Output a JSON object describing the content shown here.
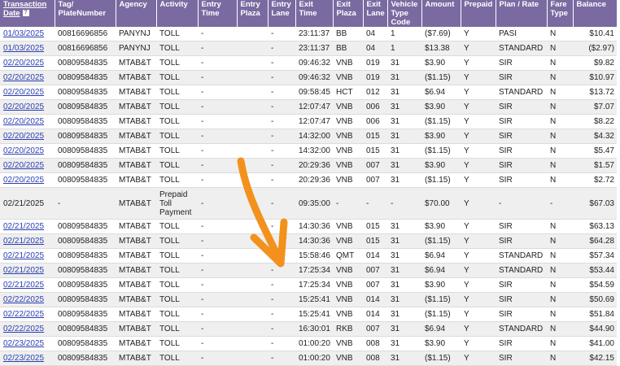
{
  "headers": [
    {
      "lines": [
        "Transaction",
        "Date"
      ],
      "underline": true,
      "help": "?"
    },
    {
      "lines": [
        "Tag/",
        "PlateNumber"
      ]
    },
    {
      "lines": [
        "Agency"
      ]
    },
    {
      "lines": [
        "Activity"
      ]
    },
    {
      "lines": [
        "Entry",
        "Time"
      ]
    },
    {
      "lines": [
        "Entry",
        "Plaza"
      ]
    },
    {
      "lines": [
        "Entry",
        "Lane"
      ]
    },
    {
      "lines": [
        "Exit",
        "Time"
      ]
    },
    {
      "lines": [
        "Exit",
        "Plaza"
      ]
    },
    {
      "lines": [
        "Exit",
        "Lane"
      ]
    },
    {
      "lines": [
        "Vehicle",
        "Type",
        "Code"
      ]
    },
    {
      "lines": [
        "Amount"
      ]
    },
    {
      "lines": [
        "Prepaid"
      ]
    },
    {
      "lines": [
        "Plan / Rate"
      ]
    },
    {
      "lines": [
        "Fare",
        "Type"
      ]
    },
    {
      "lines": [
        "Balance"
      ]
    }
  ],
  "rows": [
    {
      "date": "01/03/2025",
      "link": true,
      "tag": "00816696856",
      "agency": "PANYNJ",
      "activity": "TOLL",
      "entry_time": "-",
      "entry_plaza": "",
      "entry_lane": "-",
      "exit_time": "23:11:37",
      "exit_plaza": "BB",
      "exit_lane": "04",
      "vtc": "1",
      "amount": "($7.69)",
      "prepaid": "Y",
      "plan": "PASI",
      "fare": "N",
      "balance": "$10.41"
    },
    {
      "date": "01/03/2025",
      "link": true,
      "tag": "00816696856",
      "agency": "PANYNJ",
      "activity": "TOLL",
      "entry_time": "-",
      "entry_plaza": "",
      "entry_lane": "-",
      "exit_time": "23:11:37",
      "exit_plaza": "BB",
      "exit_lane": "04",
      "vtc": "1",
      "amount": "$13.38",
      "prepaid": "Y",
      "plan": "STANDARD",
      "fare": "N",
      "balance": "($2.97)"
    },
    {
      "date": "02/20/2025",
      "link": true,
      "tag": "00809584835",
      "agency": "MTAB&T",
      "activity": "TOLL",
      "entry_time": "-",
      "entry_plaza": "",
      "entry_lane": "-",
      "exit_time": "09:46:32",
      "exit_plaza": "VNB",
      "exit_lane": "019",
      "vtc": "31",
      "amount": "$3.90",
      "prepaid": "Y",
      "plan": "SIR",
      "fare": "N",
      "balance": "$9.82"
    },
    {
      "date": "02/20/2025",
      "link": true,
      "tag": "00809584835",
      "agency": "MTAB&T",
      "activity": "TOLL",
      "entry_time": "-",
      "entry_plaza": "",
      "entry_lane": "-",
      "exit_time": "09:46:32",
      "exit_plaza": "VNB",
      "exit_lane": "019",
      "vtc": "31",
      "amount": "($1.15)",
      "prepaid": "Y",
      "plan": "SIR",
      "fare": "N",
      "balance": "$10.97"
    },
    {
      "date": "02/20/2025",
      "link": true,
      "tag": "00809584835",
      "agency": "MTAB&T",
      "activity": "TOLL",
      "entry_time": "-",
      "entry_plaza": "",
      "entry_lane": "-",
      "exit_time": "09:58:45",
      "exit_plaza": "HCT",
      "exit_lane": "012",
      "vtc": "31",
      "amount": "$6.94",
      "prepaid": "Y",
      "plan": "STANDARD",
      "fare": "N",
      "balance": "$13.72"
    },
    {
      "date": "02/20/2025",
      "link": true,
      "tag": "00809584835",
      "agency": "MTAB&T",
      "activity": "TOLL",
      "entry_time": "-",
      "entry_plaza": "",
      "entry_lane": "-",
      "exit_time": "12:07:47",
      "exit_plaza": "VNB",
      "exit_lane": "006",
      "vtc": "31",
      "amount": "$3.90",
      "prepaid": "Y",
      "plan": "SIR",
      "fare": "N",
      "balance": "$7.07"
    },
    {
      "date": "02/20/2025",
      "link": true,
      "tag": "00809584835",
      "agency": "MTAB&T",
      "activity": "TOLL",
      "entry_time": "-",
      "entry_plaza": "",
      "entry_lane": "-",
      "exit_time": "12:07:47",
      "exit_plaza": "VNB",
      "exit_lane": "006",
      "vtc": "31",
      "amount": "($1.15)",
      "prepaid": "Y",
      "plan": "SIR",
      "fare": "N",
      "balance": "$8.22"
    },
    {
      "date": "02/20/2025",
      "link": true,
      "tag": "00809584835",
      "agency": "MTAB&T",
      "activity": "TOLL",
      "entry_time": "-",
      "entry_plaza": "",
      "entry_lane": "-",
      "exit_time": "14:32:00",
      "exit_plaza": "VNB",
      "exit_lane": "015",
      "vtc": "31",
      "amount": "$3.90",
      "prepaid": "Y",
      "plan": "SIR",
      "fare": "N",
      "balance": "$4.32"
    },
    {
      "date": "02/20/2025",
      "link": true,
      "tag": "00809584835",
      "agency": "MTAB&T",
      "activity": "TOLL",
      "entry_time": "-",
      "entry_plaza": "",
      "entry_lane": "-",
      "exit_time": "14:32:00",
      "exit_plaza": "VNB",
      "exit_lane": "015",
      "vtc": "31",
      "amount": "($1.15)",
      "prepaid": "Y",
      "plan": "SIR",
      "fare": "N",
      "balance": "$5.47"
    },
    {
      "date": "02/20/2025",
      "link": true,
      "tag": "00809584835",
      "agency": "MTAB&T",
      "activity": "TOLL",
      "entry_time": "-",
      "entry_plaza": "",
      "entry_lane": "-",
      "exit_time": "20:29:36",
      "exit_plaza": "VNB",
      "exit_lane": "007",
      "vtc": "31",
      "amount": "$3.90",
      "prepaid": "Y",
      "plan": "SIR",
      "fare": "N",
      "balance": "$1.57"
    },
    {
      "date": "02/20/2025",
      "link": true,
      "tag": "00809584835",
      "agency": "MTAB&T",
      "activity": "TOLL",
      "entry_time": "-",
      "entry_plaza": "",
      "entry_lane": "-",
      "exit_time": "20:29:36",
      "exit_plaza": "VNB",
      "exit_lane": "007",
      "vtc": "31",
      "amount": "($1.15)",
      "prepaid": "Y",
      "plan": "SIR",
      "fare": "N",
      "balance": "$2.72"
    },
    {
      "date": "02/21/2025",
      "link": false,
      "tall": true,
      "tag": "-",
      "agency": "MTAB&T",
      "activity": "Prepaid Toll Payment",
      "entry_time": "-",
      "entry_plaza": "",
      "entry_lane": "-",
      "exit_time": "09:35:00",
      "exit_plaza": "-",
      "exit_lane": "-",
      "vtc": "-",
      "amount": "$70.00",
      "prepaid": "Y",
      "plan": "-",
      "fare": "-",
      "balance": "$67.03"
    },
    {
      "date": "02/21/2025",
      "link": true,
      "tag": "00809584835",
      "agency": "MTAB&T",
      "activity": "TOLL",
      "entry_time": "-",
      "entry_plaza": "",
      "entry_lane": "-",
      "exit_time": "14:30:36",
      "exit_plaza": "VNB",
      "exit_lane": "015",
      "vtc": "31",
      "amount": "$3.90",
      "prepaid": "Y",
      "plan": "SIR",
      "fare": "N",
      "balance": "$63.13"
    },
    {
      "date": "02/21/2025",
      "link": true,
      "tag": "00809584835",
      "agency": "MTAB&T",
      "activity": "TOLL",
      "entry_time": "-",
      "entry_plaza": "",
      "entry_lane": "-",
      "exit_time": "14:30:36",
      "exit_plaza": "VNB",
      "exit_lane": "015",
      "vtc": "31",
      "amount": "($1.15)",
      "prepaid": "Y",
      "plan": "SIR",
      "fare": "N",
      "balance": "$64.28"
    },
    {
      "date": "02/21/2025",
      "link": true,
      "tag": "00809584835",
      "agency": "MTAB&T",
      "activity": "TOLL",
      "entry_time": "-",
      "entry_plaza": "",
      "entry_lane": "-",
      "exit_time": "15:58:46",
      "exit_plaza": "QMT",
      "exit_lane": "014",
      "vtc": "31",
      "amount": "$6.94",
      "prepaid": "Y",
      "plan": "STANDARD",
      "fare": "N",
      "balance": "$57.34"
    },
    {
      "date": "02/21/2025",
      "link": true,
      "tag": "00809584835",
      "agency": "MTAB&T",
      "activity": "TOLL",
      "entry_time": "-",
      "entry_plaza": "",
      "entry_lane": "-",
      "exit_time": "17:25:34",
      "exit_plaza": "VNB",
      "exit_lane": "007",
      "vtc": "31",
      "amount": "$6.94",
      "prepaid": "Y",
      "plan": "STANDARD",
      "fare": "N",
      "balance": "$53.44"
    },
    {
      "date": "02/21/2025",
      "link": true,
      "tag": "00809584835",
      "agency": "MTAB&T",
      "activity": "TOLL",
      "entry_time": "-",
      "entry_plaza": "",
      "entry_lane": "-",
      "exit_time": "17:25:34",
      "exit_plaza": "VNB",
      "exit_lane": "007",
      "vtc": "31",
      "amount": "$3.90",
      "prepaid": "Y",
      "plan": "SIR",
      "fare": "N",
      "balance": "$54.59"
    },
    {
      "date": "02/22/2025",
      "link": true,
      "tag": "00809584835",
      "agency": "MTAB&T",
      "activity": "TOLL",
      "entry_time": "-",
      "entry_plaza": "",
      "entry_lane": "-",
      "exit_time": "15:25:41",
      "exit_plaza": "VNB",
      "exit_lane": "014",
      "vtc": "31",
      "amount": "($1.15)",
      "prepaid": "Y",
      "plan": "SIR",
      "fare": "N",
      "balance": "$50.69"
    },
    {
      "date": "02/22/2025",
      "link": true,
      "tag": "00809584835",
      "agency": "MTAB&T",
      "activity": "TOLL",
      "entry_time": "-",
      "entry_plaza": "",
      "entry_lane": "-",
      "exit_time": "15:25:41",
      "exit_plaza": "VNB",
      "exit_lane": "014",
      "vtc": "31",
      "amount": "($1.15)",
      "prepaid": "Y",
      "plan": "SIR",
      "fare": "N",
      "balance": "$51.84"
    },
    {
      "date": "02/22/2025",
      "link": true,
      "tag": "00809584835",
      "agency": "MTAB&T",
      "activity": "TOLL",
      "entry_time": "-",
      "entry_plaza": "",
      "entry_lane": "-",
      "exit_time": "16:30:01",
      "exit_plaza": "RKB",
      "exit_lane": "007",
      "vtc": "31",
      "amount": "$6.94",
      "prepaid": "Y",
      "plan": "STANDARD",
      "fare": "N",
      "balance": "$44.90"
    },
    {
      "date": "02/23/2025",
      "link": true,
      "tag": "00809584835",
      "agency": "MTAB&T",
      "activity": "TOLL",
      "entry_time": "-",
      "entry_plaza": "",
      "entry_lane": "-",
      "exit_time": "01:00:20",
      "exit_plaza": "VNB",
      "exit_lane": "008",
      "vtc": "31",
      "amount": "$3.90",
      "prepaid": "Y",
      "plan": "SIR",
      "fare": "N",
      "balance": "$41.00"
    },
    {
      "date": "02/23/2025",
      "link": true,
      "tag": "00809584835",
      "agency": "MTAB&T",
      "activity": "TOLL",
      "entry_time": "-",
      "entry_plaza": "",
      "entry_lane": "-",
      "exit_time": "01:00:20",
      "exit_plaza": "VNB",
      "exit_lane": "008",
      "vtc": "31",
      "amount": "($1.15)",
      "prepaid": "Y",
      "plan": "SIR",
      "fare": "N",
      "balance": "$42.15"
    }
  ],
  "colors": {
    "header_bg": "#7a6aa1",
    "link": "#2a3fb0",
    "arrow": "#f2921d"
  },
  "annotation": {
    "icon": "orange-arrow-icon"
  }
}
